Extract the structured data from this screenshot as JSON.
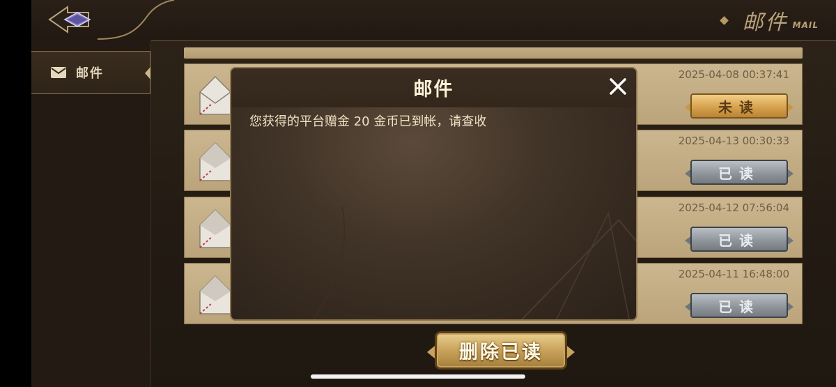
{
  "header": {
    "title": "邮件",
    "subtitle": "MAIL"
  },
  "sidebar": {
    "tabs": [
      {
        "label": "邮件",
        "icon": "mail-icon",
        "active": true
      }
    ]
  },
  "mail_list": {
    "items": [
      {
        "date": "2025-04-08 00:37:41",
        "status_label": "未读",
        "read": false
      },
      {
        "date": "2025-04-13 00:30:33",
        "status_label": "已读",
        "read": true
      },
      {
        "date": "2025-04-12 07:56:04",
        "status_label": "已读",
        "read": true
      },
      {
        "date": "2025-04-11 16:48:00",
        "status_label": "已读",
        "read": true
      }
    ]
  },
  "actions": {
    "delete_read_label": "删除已读"
  },
  "modal": {
    "title": "邮件",
    "body": "您获得的平台赠金 20 金币已到帐，请查收",
    "close_icon": "close-icon"
  },
  "colors": {
    "gold_accent": "#d9a554",
    "row_background": "#c3ad84",
    "read_button": "#8f969c",
    "modal_background": "#3f3226"
  }
}
